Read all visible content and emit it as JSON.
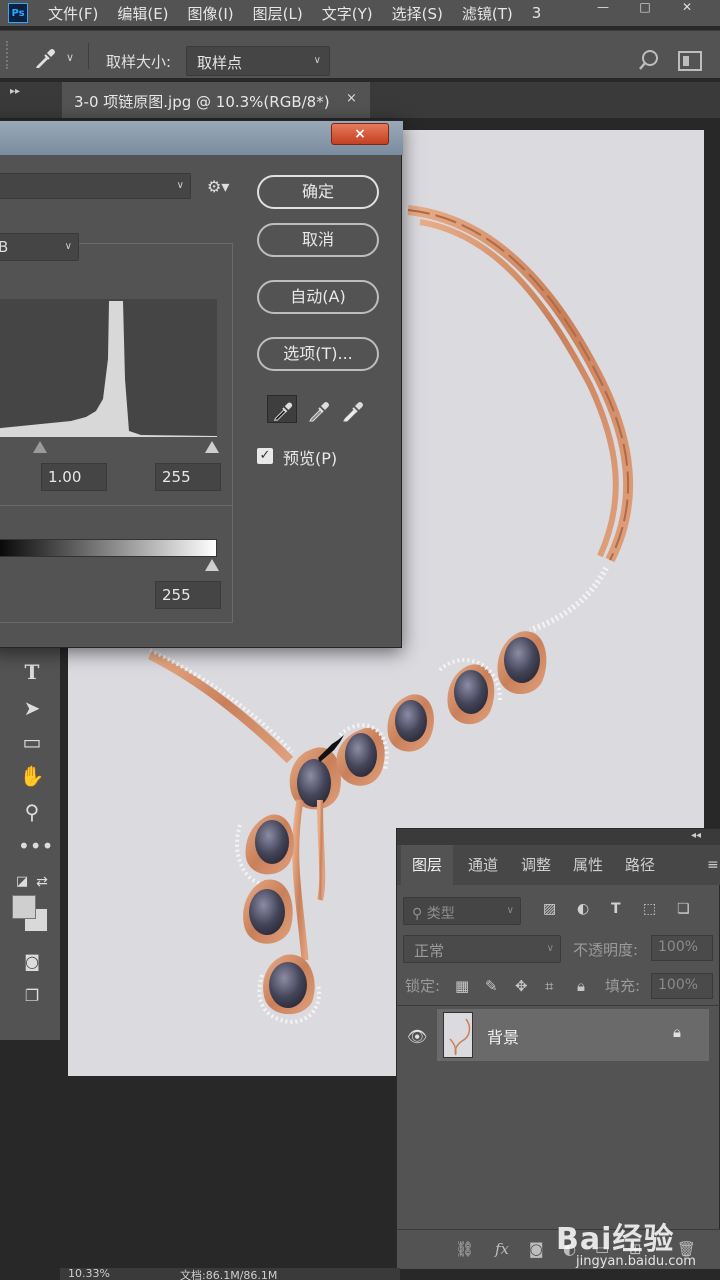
{
  "menu": {
    "logo": "Ps",
    "items": [
      "文件(F)",
      "编辑(E)",
      "图像(I)",
      "图层(L)",
      "文字(Y)",
      "选择(S)",
      "滤镜(T)",
      "3"
    ]
  },
  "options_bar": {
    "sample_size_label": "取样大小:",
    "sample_size_value": "取样点"
  },
  "document_tab": {
    "title": "3-0 项链原图.jpg @ 10.3%(RGB/8*)",
    "close": "×"
  },
  "levels_dialog": {
    "close": "×",
    "channel_value": "B",
    "input_gamma": "1.00",
    "input_white": "255",
    "output_white": "255",
    "buttons": {
      "ok": "确定",
      "cancel": "取消",
      "auto": "自动(A)",
      "options": "选项(T)..."
    },
    "preview_label": "预览(P)",
    "preview_checked": true
  },
  "toolbar": {
    "icons": [
      "type-tool-icon",
      "path-selection-icon",
      "rectangle-tool-icon",
      "hand-tool-icon",
      "zoom-tool-icon",
      "more-tools-icon"
    ]
  },
  "layers_panel": {
    "tabs": [
      "图层",
      "通道",
      "调整",
      "属性",
      "路径"
    ],
    "active_tab": "图层",
    "filter_placeholder": "类型",
    "blend_mode": "正常",
    "opacity_label": "不透明度:",
    "opacity_value": "100%",
    "lock_label": "锁定:",
    "fill_label": "填充:",
    "fill_value": "100%",
    "layers": [
      {
        "name": "背景",
        "visible": true,
        "locked": true
      }
    ]
  },
  "status_bar": {
    "zoom": "10.33%",
    "doc_info": "文档:86.1M/86.1M"
  },
  "watermark": {
    "brand": "Bai经验",
    "url": "jingyan.baidu.com"
  },
  "colors": {
    "panel": "#535353",
    "canvas": "#dbdadf",
    "rose_gold": "#d4906a",
    "gem": "#4a4a5e"
  }
}
